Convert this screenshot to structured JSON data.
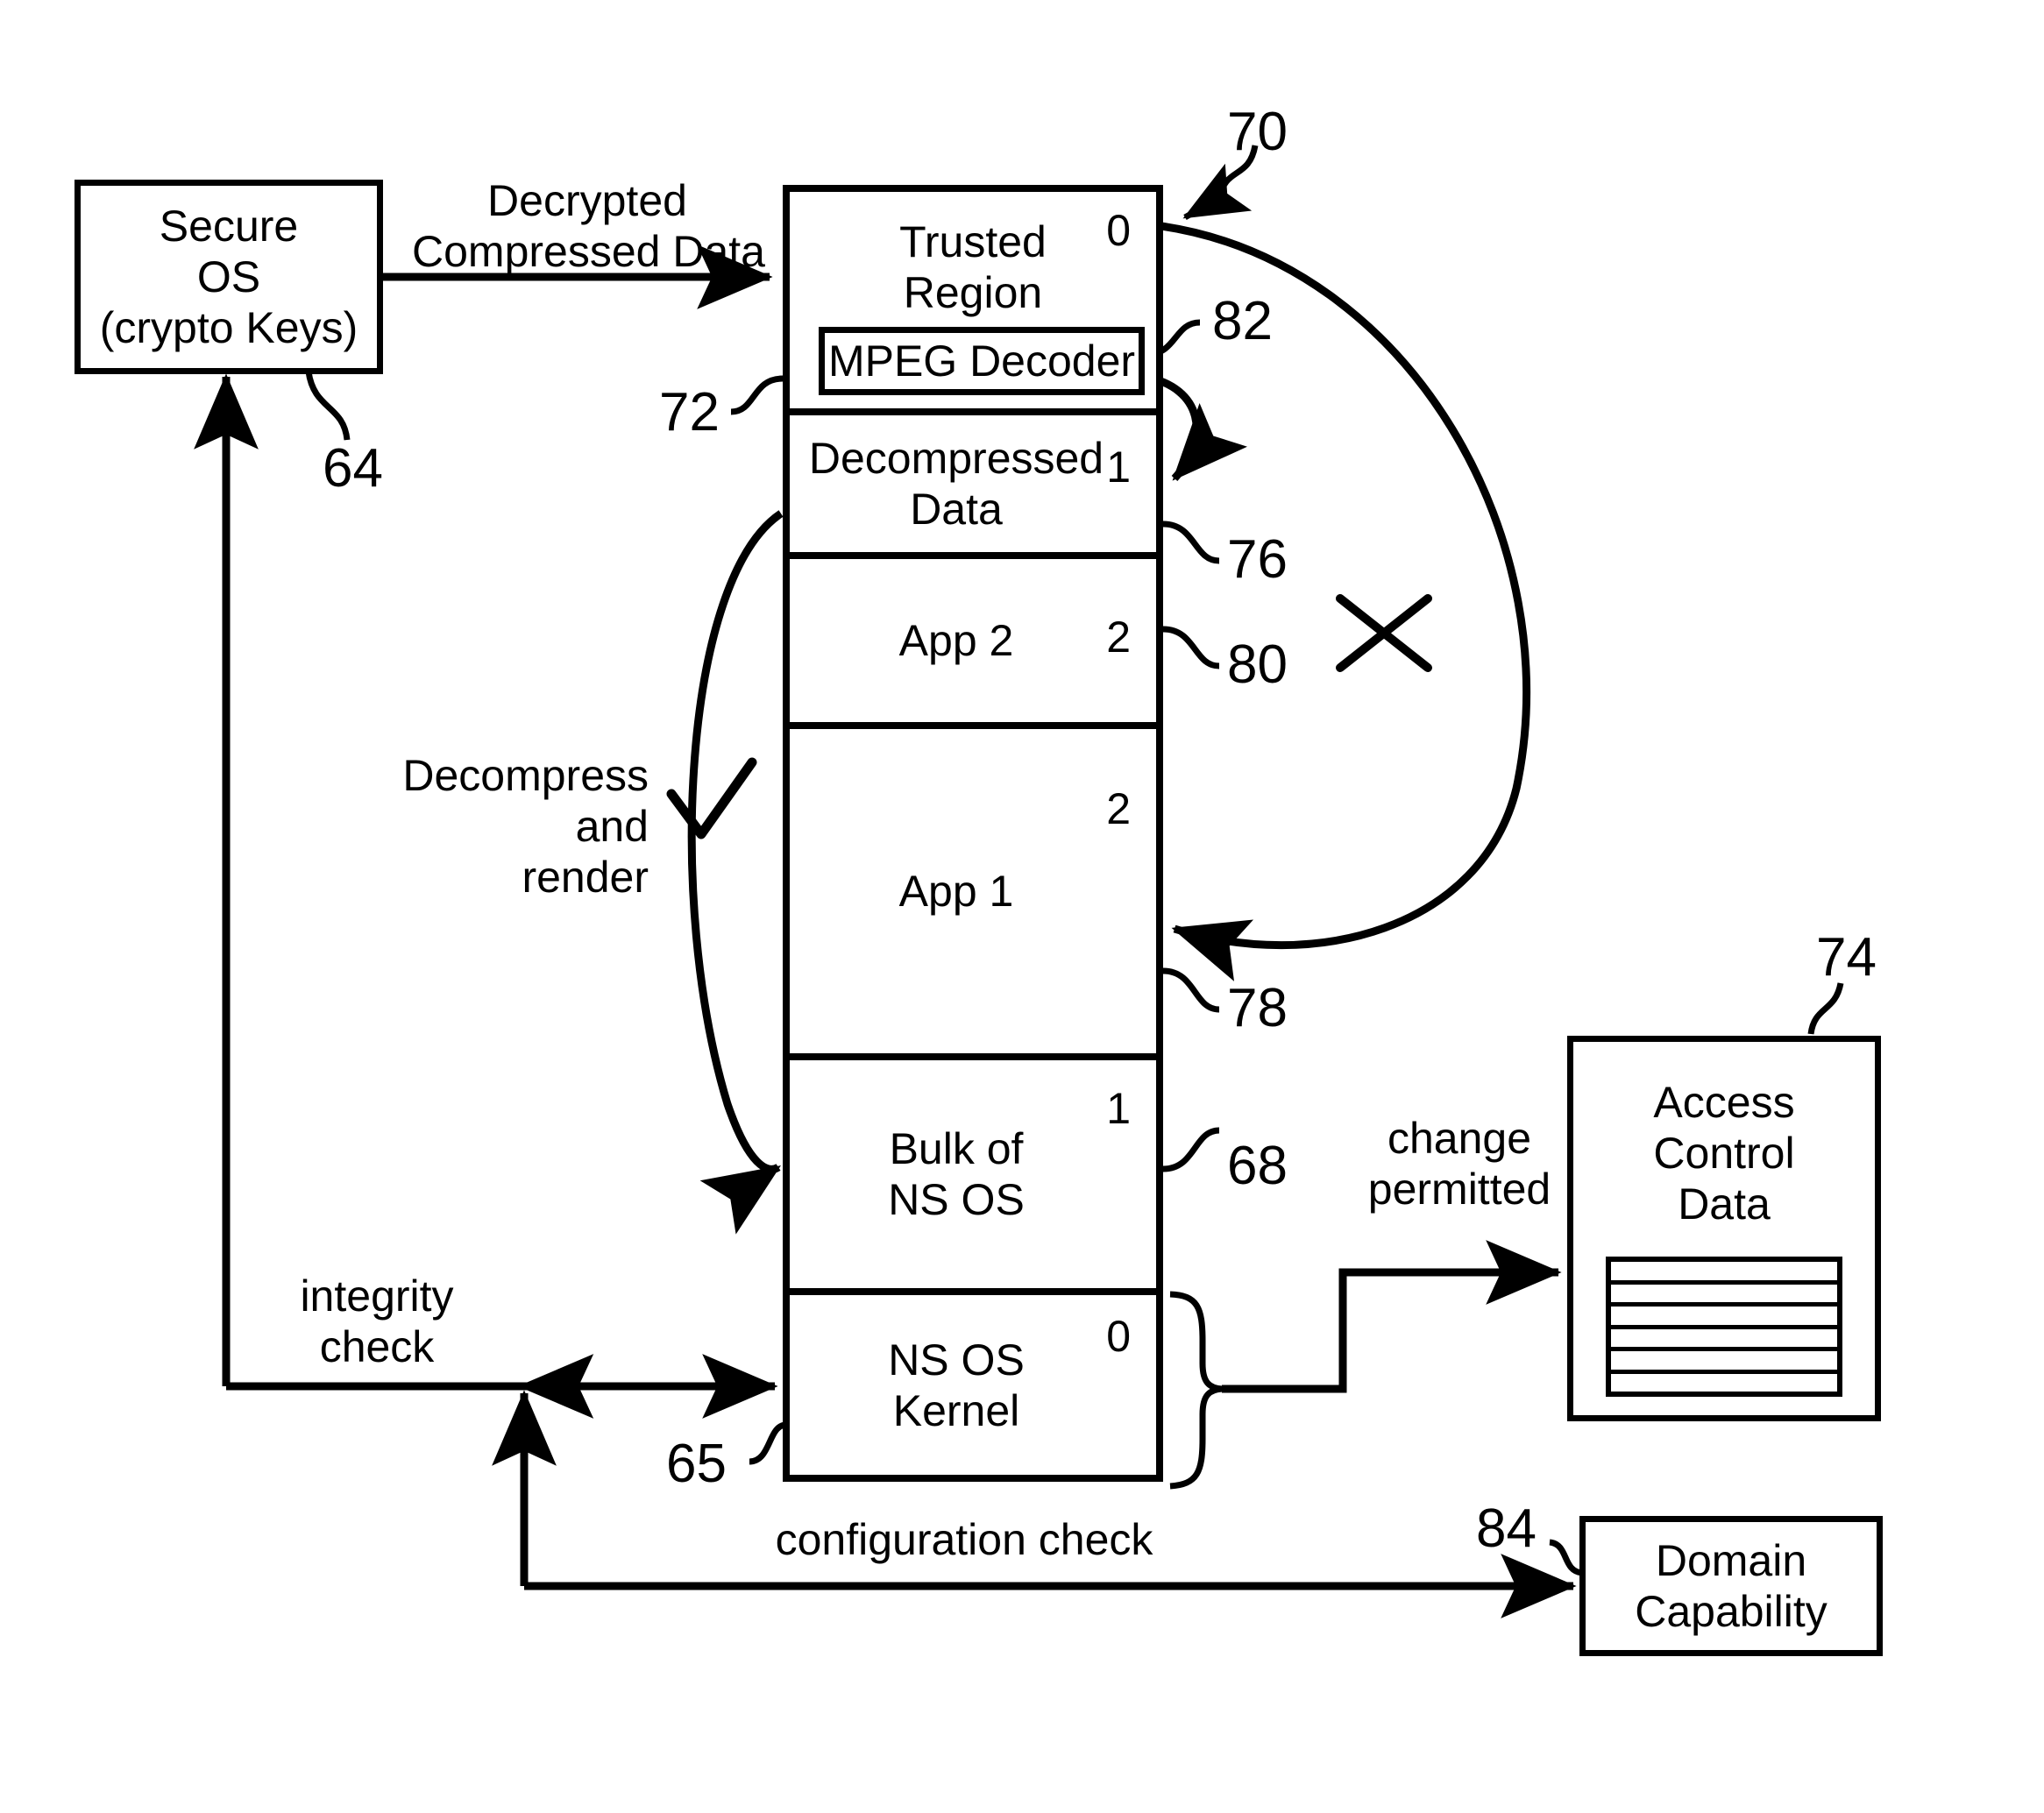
{
  "figure": {
    "kind": "patent-diagram",
    "stroke_color": "#000000",
    "background_color": "#ffffff"
  },
  "boxes": {
    "secure_os": {
      "lines": [
        "Secure",
        "OS",
        "(crypto Keys)"
      ],
      "ref": "64"
    },
    "access_control": {
      "lines": [
        "Access",
        "Control",
        "Data"
      ],
      "ref": "74",
      "table_rows": 6
    },
    "domain_capability": {
      "lines": [
        "Domain",
        "Capability"
      ],
      "ref": "84"
    },
    "mpeg_decoder": {
      "label": "MPEG Decoder",
      "ref": "82"
    }
  },
  "memory_column": {
    "ref": "70",
    "left_ref": "72",
    "bottom_ref": "65",
    "regions": [
      {
        "name": "trusted-region",
        "lines": [
          "Trusted",
          "Region"
        ],
        "domain": "0",
        "ref": ""
      },
      {
        "name": "decompressed-data",
        "lines": [
          "Decompressed",
          "Data"
        ],
        "domain": "1",
        "ref": "76"
      },
      {
        "name": "app-2",
        "lines": [
          "App 2"
        ],
        "domain": "2",
        "ref": "80"
      },
      {
        "name": "app-1",
        "lines": [
          "App 1"
        ],
        "domain": "2",
        "ref": "78"
      },
      {
        "name": "bulk-of-ns-os",
        "lines": [
          "Bulk of",
          "NS OS"
        ],
        "domain": "1",
        "ref": "68"
      },
      {
        "name": "ns-os-kernel",
        "lines": [
          "NS OS",
          "Kernel"
        ],
        "domain": "0",
        "ref": ""
      }
    ]
  },
  "edges": {
    "decrypted_compressed_data": {
      "lines": [
        "Decrypted",
        "Compressed Data"
      ]
    },
    "decompress_and_render": {
      "lines": [
        "Decompress",
        "and",
        "render"
      ],
      "marker": "check"
    },
    "blocked_access": {
      "marker": "cross"
    },
    "change_permitted": {
      "lines": [
        "change",
        "permitted"
      ]
    },
    "integrity_check": {
      "lines": [
        "integrity",
        "check"
      ]
    },
    "configuration_check": {
      "lines": [
        "configuration check"
      ]
    }
  },
  "reference_numerals": {
    "n64": "64",
    "n65": "65",
    "n68": "68",
    "n70": "70",
    "n72": "72",
    "n74": "74",
    "n76": "76",
    "n78": "78",
    "n80": "80",
    "n82": "82",
    "n84": "84"
  }
}
